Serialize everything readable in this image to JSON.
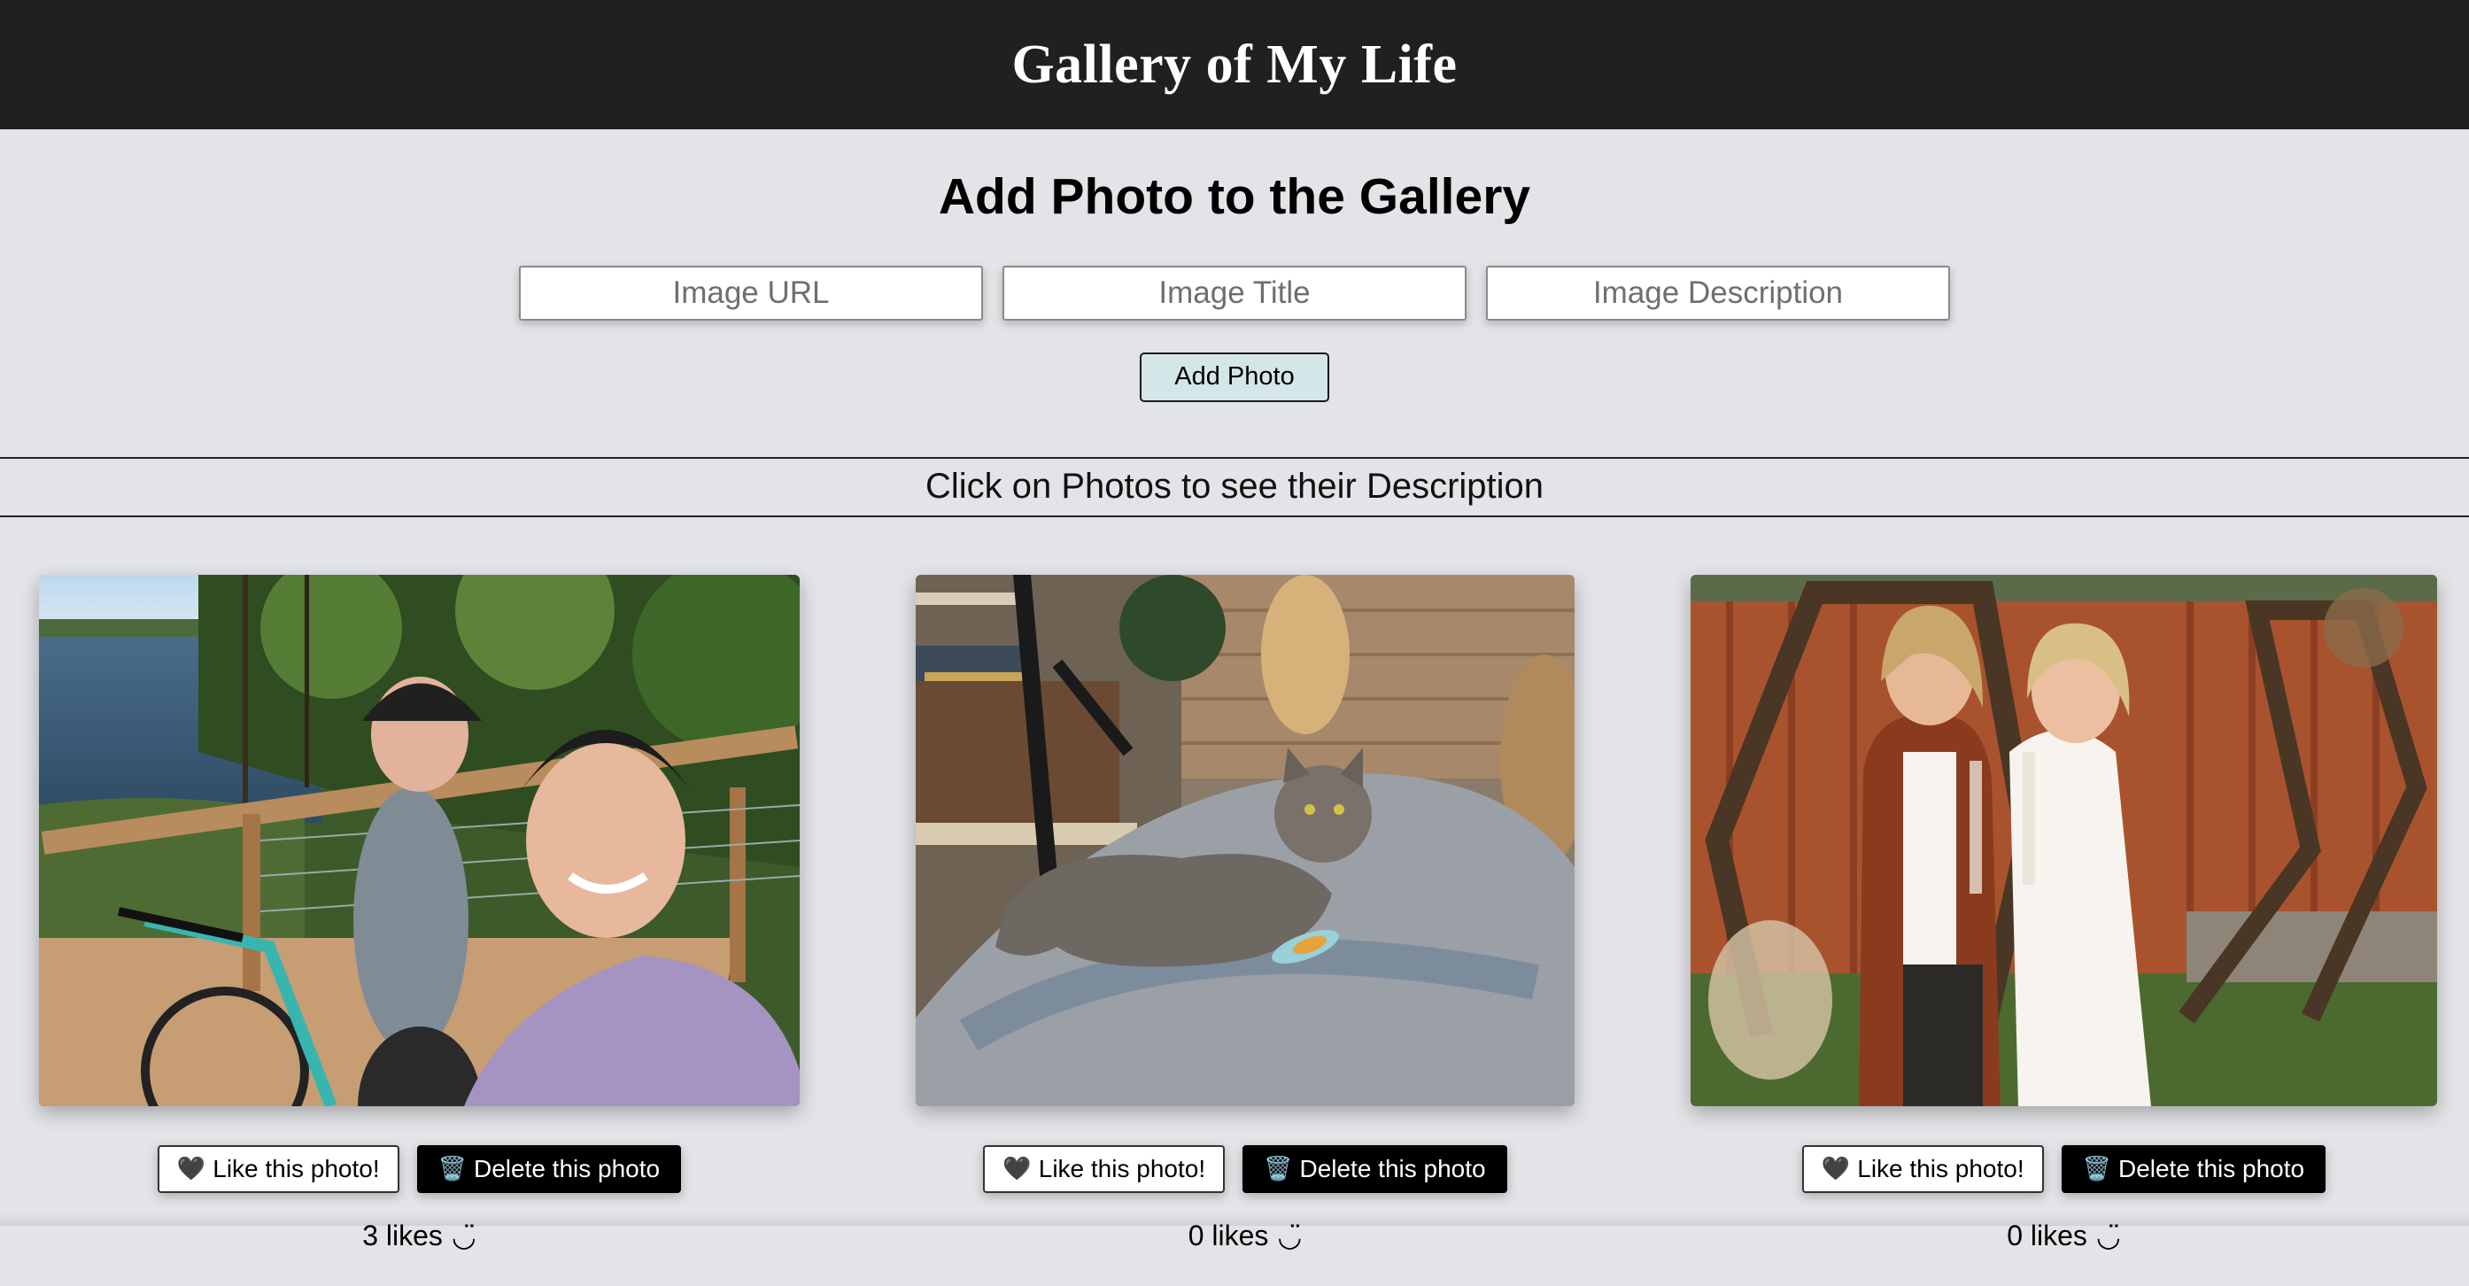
{
  "header": {
    "title": "Gallery of My Life"
  },
  "form": {
    "heading": "Add Photo to the Gallery",
    "url_placeholder": "Image URL",
    "title_placeholder": "Image Title",
    "description_placeholder": "Image Description",
    "submit_label": "Add Photo"
  },
  "instructions": "Click on Photos to see their Description",
  "photos": [
    {
      "subject": "Two women in bike helmets taking a selfie on a lakeside boardwalk",
      "like_icon": "black-heart-icon",
      "like_glyph": "🖤",
      "like_label": "Like this photo!",
      "delete_icon": "trash-icon",
      "delete_glyph": "🗑️",
      "delete_label": "Delete this photo",
      "likes_text": "3 likes",
      "smile": "◡̈"
    },
    {
      "subject": "Fluffy grey cat lying on a rug next to a toy",
      "like_icon": "black-heart-icon",
      "like_glyph": "🖤",
      "like_label": "Like this photo!",
      "delete_icon": "trash-icon",
      "delete_glyph": "🗑️",
      "delete_label": "Delete this photo",
      "likes_text": "0 likes",
      "smile": "◡̈"
    },
    {
      "subject": "Wedding couple holding champagne glasses in front of a hexagon arch",
      "like_icon": "black-heart-icon",
      "like_glyph": "🖤",
      "like_label": "Like this photo!",
      "delete_icon": "trash-icon",
      "delete_glyph": "🗑️",
      "delete_label": "Delete this photo",
      "likes_text": "0 likes",
      "smile": "◡̈"
    }
  ],
  "colors": {
    "header_bg": "#202020",
    "page_bg": "#e3e4e7",
    "add_button_bg": "#d5e6e9",
    "delete_button_bg": "#000000"
  }
}
